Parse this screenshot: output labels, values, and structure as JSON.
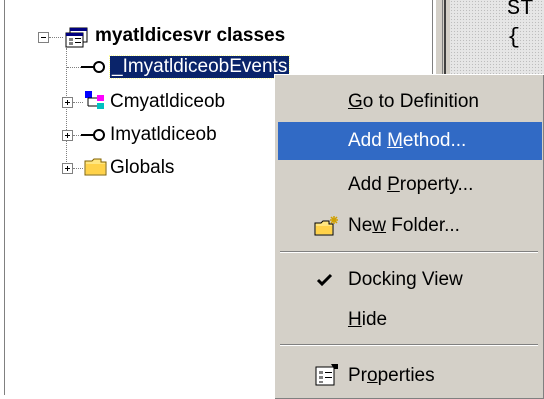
{
  "tree": {
    "root_label": "myatldicesvr classes",
    "items": [
      {
        "label": "_ImyatldiceobEvents",
        "kind": "interface",
        "selected": true
      },
      {
        "label": "Cmyatldiceob",
        "kind": "class"
      },
      {
        "label": "Imyatldiceob",
        "kind": "interface"
      },
      {
        "label": "Globals",
        "kind": "folder"
      }
    ]
  },
  "code": {
    "line1": "ST",
    "line2": "{"
  },
  "menu": {
    "items": [
      {
        "pre": "",
        "key": "G",
        "post": "o to Definition",
        "icon": ""
      },
      {
        "pre": "Add ",
        "key": "M",
        "post": "ethod...",
        "icon": "",
        "active": true
      },
      {
        "pre": "Add ",
        "key": "P",
        "post": "roperty...",
        "icon": ""
      },
      {
        "pre": "Ne",
        "key": "w",
        "post": " Folder...",
        "icon": "new-folder-icon"
      },
      {
        "pre": "",
        "key": "",
        "post": "Docking View",
        "icon": "checkmark-icon",
        "checked": true
      },
      {
        "pre": "",
        "key": "H",
        "post": "ide",
        "icon": ""
      },
      {
        "pre": "Pr",
        "key": "o",
        "post": "perties",
        "icon": "properties-icon"
      }
    ]
  },
  "colors": {
    "highlight": "#316ac5",
    "selection": "#0a246a",
    "face": "#d4d0c8"
  }
}
